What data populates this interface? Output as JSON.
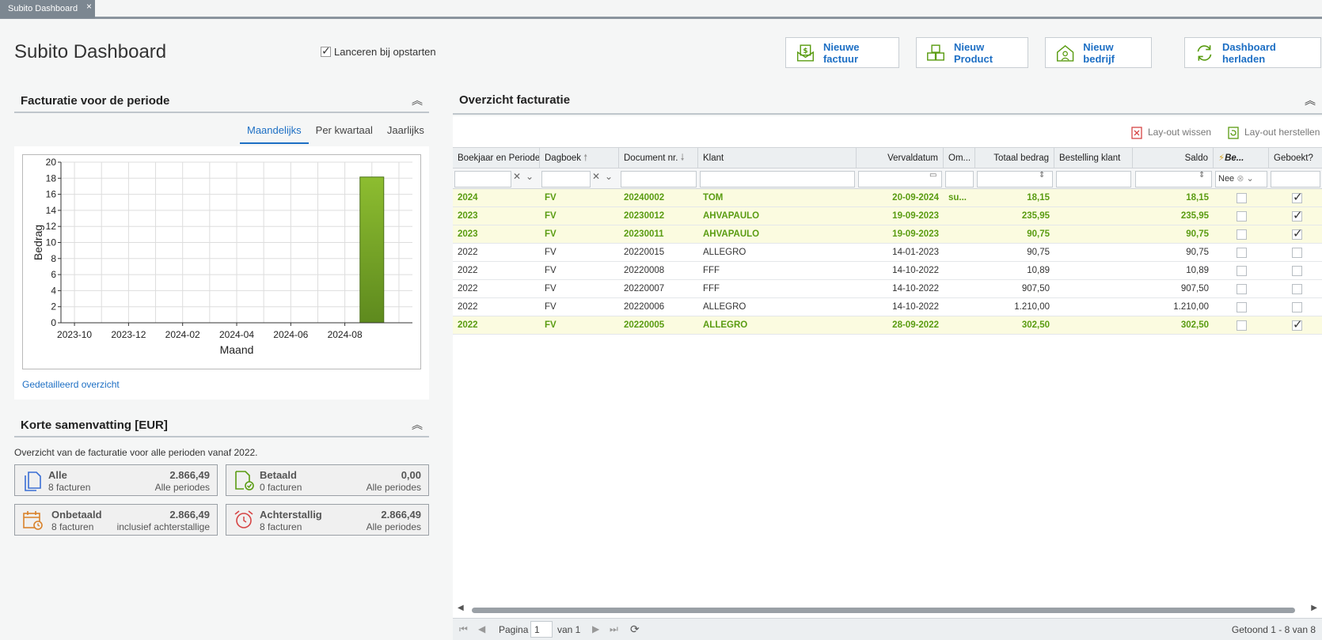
{
  "tab": {
    "label": "Subito Dashboard",
    "close": "×"
  },
  "page": {
    "title": "Subito Dashboard",
    "launch_label": "Lanceren bij opstarten"
  },
  "buttons": {
    "new_invoice": "Nieuwe factuur",
    "new_product": "Nieuw Product",
    "new_company": "Nieuw bedrijf",
    "reload": "Dashboard herladen"
  },
  "invoicing_panel": {
    "title": "Facturatie voor de periode",
    "periods": [
      "Maandelijks",
      "Per kwartaal",
      "Jaarlijks"
    ],
    "active_period": "Maandelijks",
    "detail_link": "Gedetailleerd overzicht"
  },
  "chart_data": {
    "type": "bar",
    "categories": [
      "2024-09"
    ],
    "values": [
      18.15
    ],
    "xlabel": "Maand",
    "ylabel": "Bedrag",
    "ylim": [
      0,
      20
    ],
    "yticks": [
      "0",
      "2",
      "4",
      "6",
      "8",
      "10",
      "12",
      "14",
      "16",
      "18",
      "20"
    ],
    "xticks": [
      "2023-10",
      "2023-12",
      "2024-02",
      "2024-04",
      "2024-06",
      "2024-08"
    ],
    "grid": true,
    "bar_color": "#6e9f27"
  },
  "summary": {
    "title": "Korte samenvatting [EUR]",
    "text": "Overzicht van de facturatie voor alle perioden vanaf 2022.",
    "cards": [
      {
        "label": "Alle",
        "count": "8 facturen",
        "amount": "2.866,49",
        "note": "Alle periodes",
        "icon": "documents-icon",
        "color": "#3b6fd4"
      },
      {
        "label": "Betaald",
        "count": "0 facturen",
        "amount": "0,00",
        "note": "Alle periodes",
        "icon": "paid-document-icon",
        "color": "#5a9c12"
      },
      {
        "label": "Onbetaald",
        "count": "8 facturen",
        "amount": "2.866,49",
        "note": "inclusief achterstallige",
        "icon": "calendar-clock-icon",
        "color": "#d9822b"
      },
      {
        "label": "Achterstallig",
        "count": "8 facturen",
        "amount": "2.866,49",
        "note": "Alle periodes",
        "icon": "alarm-clock-icon",
        "color": "#d64545"
      }
    ]
  },
  "overview": {
    "title": "Overzicht facturatie",
    "clear_layout": "Lay-out wissen",
    "restore_layout": "Lay-out herstellen",
    "columns": [
      "Boekjaar en Perioden",
      "Dagboek",
      "Document nr.",
      "Klant",
      "Vervaldatum",
      "Om...",
      "Totaal bedrag",
      "Bestelling klant",
      "Saldo",
      "Be...",
      "Geboekt?"
    ],
    "filter_nee": "Nee",
    "rows": [
      {
        "year": "2024",
        "journal": "FV",
        "doc": "20240002",
        "client": "TOM",
        "due": "20-09-2024",
        "om": "su...",
        "total": "18,15",
        "saldo": "18,15",
        "booked": true,
        "hl": true
      },
      {
        "year": "2023",
        "journal": "FV",
        "doc": "20230012",
        "client": "AHVAPAULO",
        "due": "19-09-2023",
        "om": "",
        "total": "235,95",
        "saldo": "235,95",
        "booked": true,
        "hl": true
      },
      {
        "year": "2023",
        "journal": "FV",
        "doc": "20230011",
        "client": "AHVAPAULO",
        "due": "19-09-2023",
        "om": "",
        "total": "90,75",
        "saldo": "90,75",
        "booked": true,
        "hl": true
      },
      {
        "year": "2022",
        "journal": "FV",
        "doc": "20220015",
        "client": "ALLEGRO",
        "due": "14-01-2023",
        "om": "",
        "total": "90,75",
        "saldo": "90,75",
        "booked": false,
        "hl": false
      },
      {
        "year": "2022",
        "journal": "FV",
        "doc": "20220008",
        "client": "FFF",
        "due": "14-10-2022",
        "om": "",
        "total": "10,89",
        "saldo": "10,89",
        "booked": false,
        "hl": false
      },
      {
        "year": "2022",
        "journal": "FV",
        "doc": "20220007",
        "client": "FFF",
        "due": "14-10-2022",
        "om": "",
        "total": "907,50",
        "saldo": "907,50",
        "booked": false,
        "hl": false
      },
      {
        "year": "2022",
        "journal": "FV",
        "doc": "20220006",
        "client": "ALLEGRO",
        "due": "14-10-2022",
        "om": "",
        "total": "1.210,00",
        "saldo": "1.210,00",
        "booked": false,
        "hl": false
      },
      {
        "year": "2022",
        "journal": "FV",
        "doc": "20220005",
        "client": "ALLEGRO",
        "due": "28-09-2022",
        "om": "",
        "total": "302,50",
        "saldo": "302,50",
        "booked": true,
        "hl": true
      }
    ]
  },
  "pager": {
    "page_label": "Pagina",
    "page_value": "1",
    "of_label": "van 1",
    "shown": "Getoond 1 - 8 van 8"
  },
  "colors": {
    "accent": "#1d6fc4",
    "highlight_row": "#fbfbe0",
    "highlight_text": "#5a9c12"
  }
}
